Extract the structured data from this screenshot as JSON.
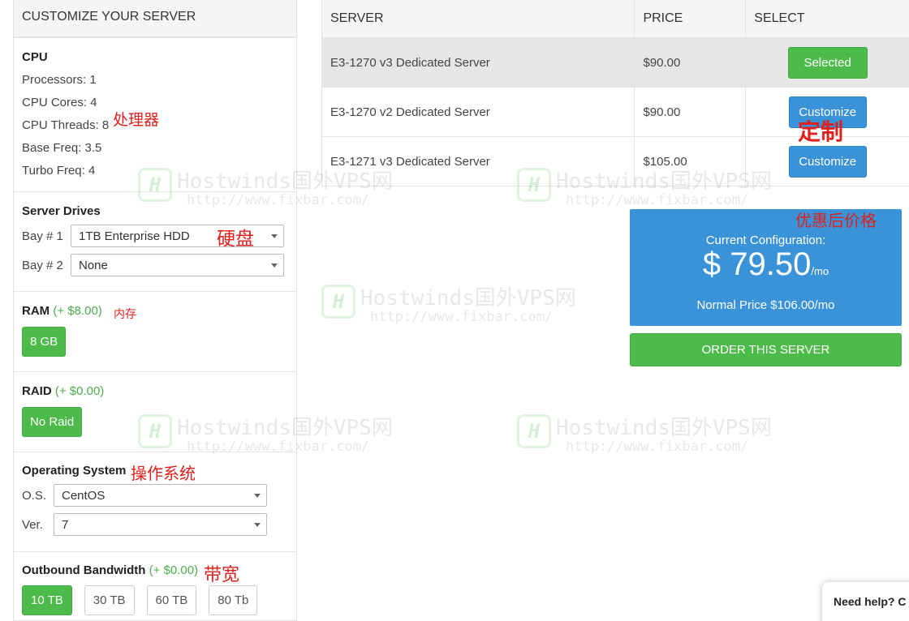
{
  "left": {
    "header": "CUSTOMIZE YOUR SERVER",
    "cpu": {
      "title": "CPU",
      "specs": [
        "Processors: 1",
        "CPU Cores: 4",
        "CPU Threads: 8",
        "Base Freq: 3.5",
        "Turbo Freq: 4"
      ]
    },
    "drives": {
      "title": "Server Drives",
      "bay1_label": "Bay # 1",
      "bay1_value": "1TB Enterprise HDD",
      "bay2_label": "Bay # 2",
      "bay2_value": "None"
    },
    "ram": {
      "title": "RAM",
      "addon": "(+ $8.00)",
      "option": "8 GB"
    },
    "raid": {
      "title": "RAID",
      "addon": "(+ $0.00)",
      "option": "No Raid"
    },
    "os": {
      "title": "Operating System",
      "os_label": "O.S.",
      "os_value": "CentOS",
      "ver_label": "Ver.",
      "ver_value": "7"
    },
    "bandwidth": {
      "title": "Outbound Bandwidth",
      "addon": "(+ $0.00)",
      "options": [
        "10 TB",
        "30 TB",
        "60 TB",
        "80 Tb"
      ]
    }
  },
  "table": {
    "headers": [
      "SERVER",
      "PRICE",
      "SELECT"
    ],
    "rows": [
      {
        "server": "E3-1270 v3 Dedicated Server",
        "price": "$90.00",
        "action": "Selected"
      },
      {
        "server": "E3-1270 v2 Dedicated Server",
        "price": "$90.00",
        "action": "Customize"
      },
      {
        "server": "E3-1271 v3 Dedicated Server",
        "price": "$105.00",
        "action": "Customize"
      }
    ]
  },
  "summary": {
    "label": "Current Configuration:",
    "price": "$ 79.50",
    "per": "/mo",
    "normal": "Normal Price $106.00/mo",
    "order": "ORDER THIS SERVER"
  },
  "annotations": {
    "processor": "处理器",
    "disk": "硬盘",
    "memory": "内存",
    "os": "操作系统",
    "bandwidth": "带宽",
    "customize": "定制",
    "discount_price": "优惠后价格"
  },
  "watermark": {
    "line1": "Hostwinds国外VPS网",
    "line2": "http://www.fixbar.com/"
  },
  "help": "Need help? C",
  "colors": {
    "green": "#4cbb4a",
    "blue": "#3a93d9",
    "annotation_red": "#e0201b"
  }
}
